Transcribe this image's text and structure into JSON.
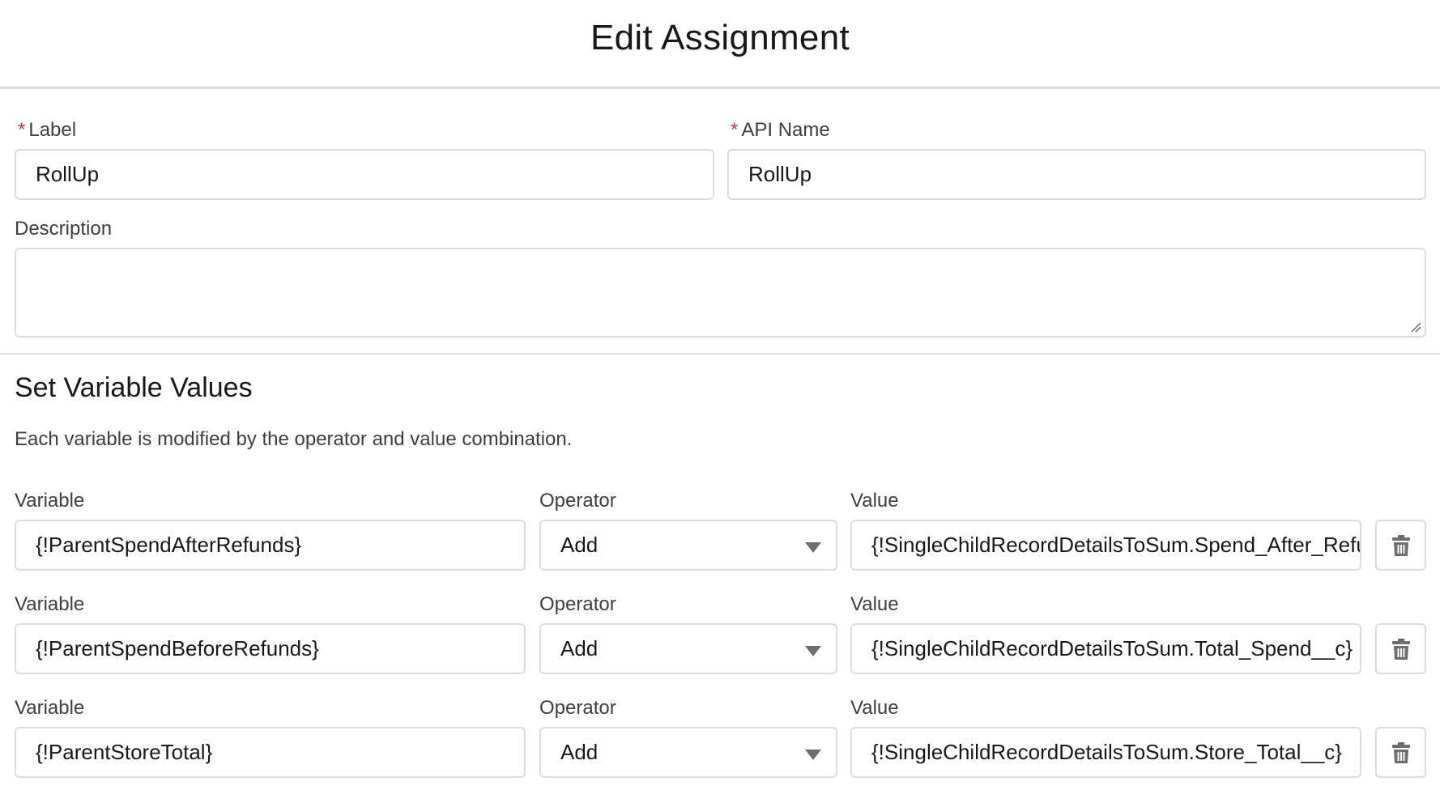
{
  "modal": {
    "title": "Edit Assignment"
  },
  "form": {
    "required_marker": "*",
    "label": {
      "label": "Label",
      "value": "RollUp"
    },
    "api_name": {
      "label": "API Name",
      "value": "RollUp"
    },
    "description": {
      "label": "Description",
      "value": ""
    }
  },
  "section": {
    "title": "Set Variable Values",
    "description": "Each variable is modified by the operator and value combination."
  },
  "assignments": [
    {
      "variable_label": "Variable",
      "variable": "{!ParentSpendAfterRefunds}",
      "operator_label": "Operator",
      "operator": "Add",
      "value_label": "Value",
      "value": "{!SingleChildRecordDetailsToSum.Spend_After_Refunds__c}"
    },
    {
      "variable_label": "Variable",
      "variable": "{!ParentSpendBeforeRefunds}",
      "operator_label": "Operator",
      "operator": "Add",
      "value_label": "Value",
      "value": "{!SingleChildRecordDetailsToSum.Total_Spend__c}"
    },
    {
      "variable_label": "Variable",
      "variable": "{!ParentStoreTotal}",
      "operator_label": "Operator",
      "operator": "Add",
      "value_label": "Value",
      "value": "{!SingleChildRecordDetailsToSum.Store_Total__c}"
    }
  ],
  "icons": {
    "delete": "trash-icon",
    "dropdown": "chevron-down-icon",
    "resize": "resize-grip-icon"
  },
  "colors": {
    "required": "#c23934",
    "border": "#dddbda",
    "icon": "#706e6b"
  }
}
